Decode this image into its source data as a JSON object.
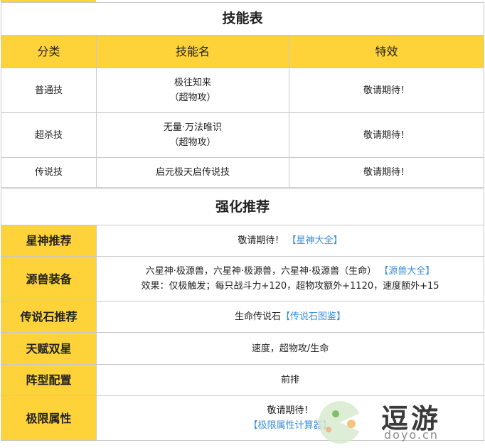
{
  "skills": {
    "title": "技能表",
    "headers": [
      "分类",
      "技能名",
      "特效"
    ],
    "rows": [
      {
        "category": "普通技",
        "name_line1": "极往知来",
        "name_line2": "（超物攻）",
        "effect": "敬请期待！"
      },
      {
        "category": "超杀技",
        "name_line1": "无量·万法唯识",
        "name_line2": "（超物攻）",
        "effect": "敬请期待！"
      },
      {
        "category": "传说技",
        "name_line1": "启元极天启传说技",
        "name_line2": "",
        "effect": "敬请期待！"
      }
    ]
  },
  "recommend": {
    "title": "强化推荐",
    "star": {
      "label": "星神推荐",
      "text": "敬请期待！",
      "link": "【星神大全】"
    },
    "beast": {
      "label": "源兽装备",
      "line1": "六星神·极源兽，六星神·极源兽，六星神·极源兽（生命）",
      "link": "【源兽大全】",
      "line2": "效果：仅极触发；每只战斗力+120，超物攻额外+1120，速度额外+15"
    },
    "stone": {
      "label": "传说石推荐",
      "text": "生命传说石",
      "link": "【传说石图鉴】"
    },
    "talent": {
      "label": "天赋双星",
      "text": "速度，超物攻/生命"
    },
    "formation": {
      "label": "阵型配置",
      "text": "前排"
    },
    "limit": {
      "label": "极限属性",
      "text": "敬请期待！",
      "link": "【极限属性计算器】"
    }
  },
  "watermark": {
    "brand": "逗游",
    "domain": "doyo.cn"
  },
  "colors": {
    "header_yellow": "#fdd339",
    "link_blue": "#3b8ed9",
    "border": "#c9c9c9"
  }
}
